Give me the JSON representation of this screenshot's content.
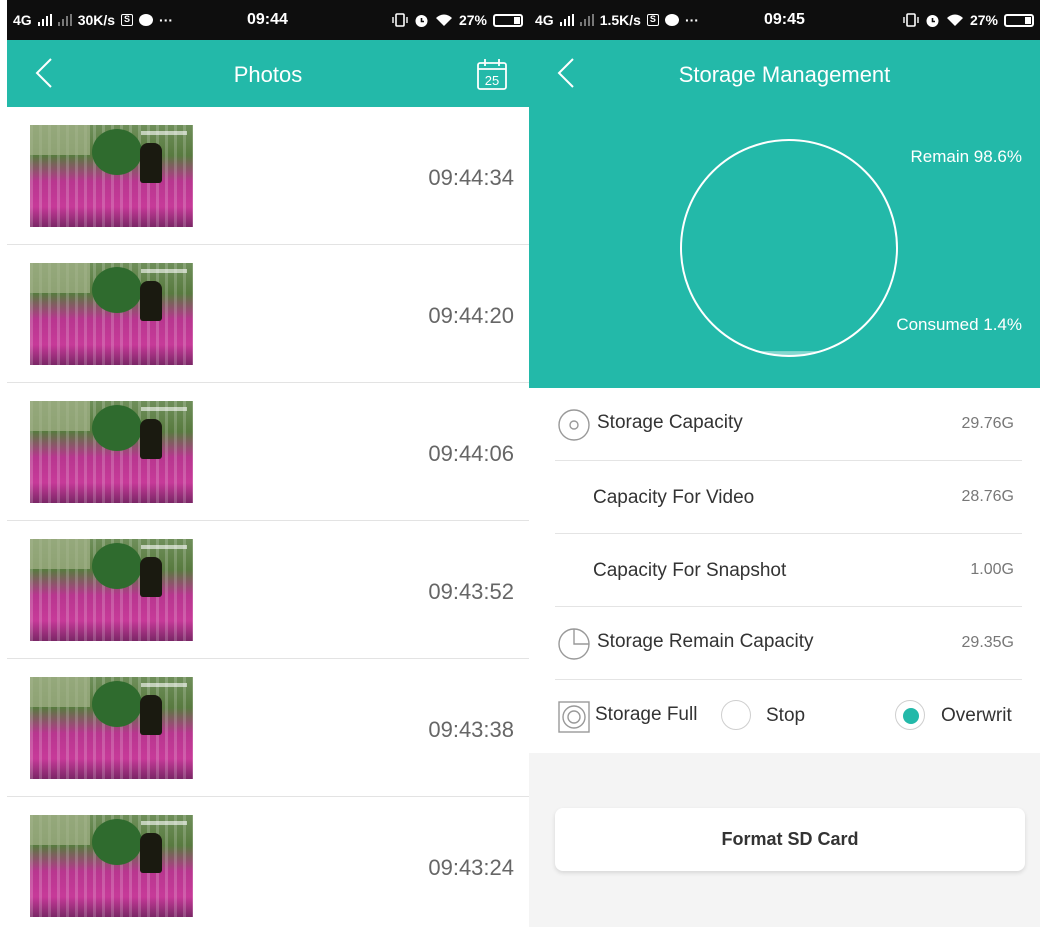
{
  "left": {
    "status": {
      "network": "4G",
      "speed": "30K/s",
      "more": "···",
      "time": "09:44",
      "battery": "27%"
    },
    "header": {
      "title": "Photos",
      "calendar_day": "25"
    },
    "photos": [
      {
        "time": "09:44:34"
      },
      {
        "time": "09:44:20"
      },
      {
        "time": "09:44:06"
      },
      {
        "time": "09:43:52"
      },
      {
        "time": "09:43:38"
      },
      {
        "time": "09:43:24"
      }
    ]
  },
  "right": {
    "status": {
      "network": "4G",
      "speed": "1.5K/s",
      "more": "···",
      "time": "09:45",
      "battery": "27%"
    },
    "header": {
      "title": "Storage Management"
    },
    "chart": {
      "remain_label": "Remain 98.6%",
      "consumed_label": "Consumed 1.4%",
      "remain_fraction": 0.986,
      "consumed_fraction": 0.014
    },
    "rows": [
      {
        "label": "Storage Capacity",
        "value": "29.76G",
        "icon": "disc-icon"
      },
      {
        "label": "Capacity For Video",
        "value": "28.76G"
      },
      {
        "label": "Capacity For Snapshot",
        "value": "1.00G"
      },
      {
        "label": "Storage Remain Capacity",
        "value": "29.35G",
        "icon": "pie-chart-icon"
      }
    ],
    "storage_full": {
      "label": "Storage Full",
      "option_stop": "Stop",
      "option_overwrite": "Overwrit",
      "selected": "overwrite"
    },
    "format_button": "Format SD Card"
  },
  "colors": {
    "accent": "#23b9a9",
    "status_bar": "#0e0e0e"
  }
}
